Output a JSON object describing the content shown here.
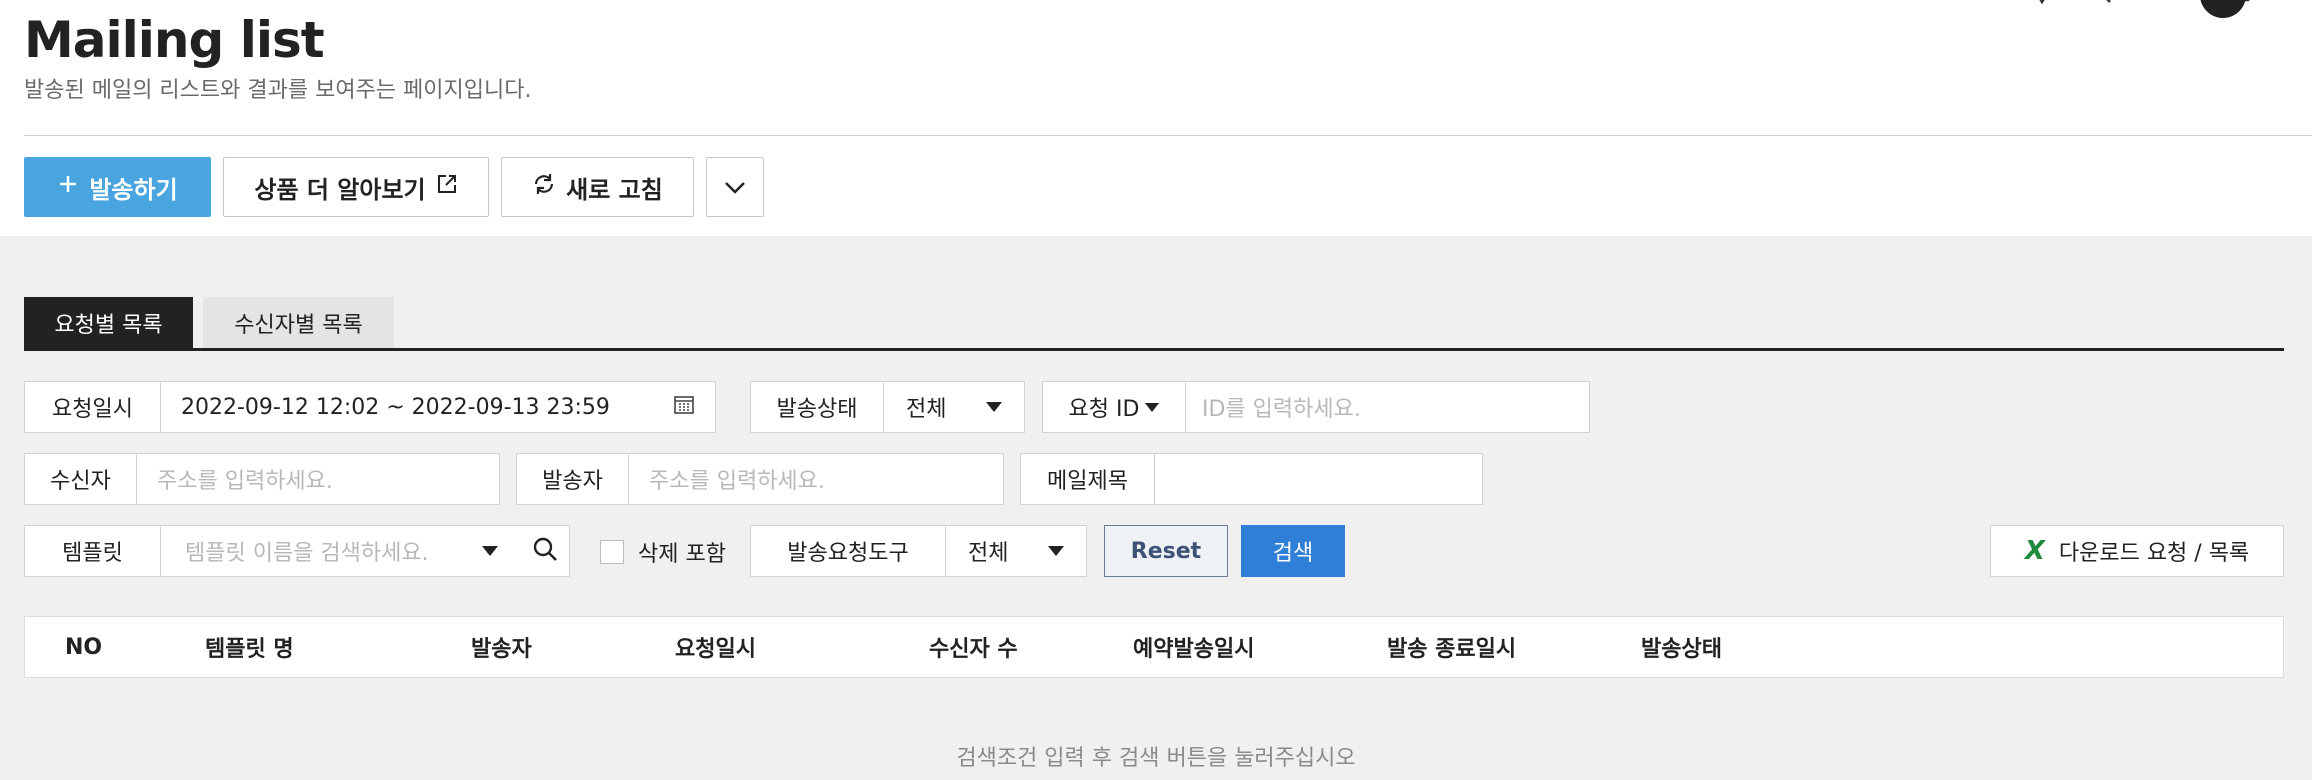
{
  "page": {
    "title": "Mailing list",
    "subtitle": "발송된 메일의 리스트와 결과를 보여주는 페이지입니다."
  },
  "toolbar": {
    "send_label": "발송하기",
    "learn_more_label": "상품 더 알아보기",
    "refresh_label": "새로 고침"
  },
  "tabs": [
    {
      "label": "요청별 목록",
      "active": true
    },
    {
      "label": "수신자별 목록",
      "active": false
    }
  ],
  "filters": {
    "request_date": {
      "label": "요청일시",
      "value": "2022-09-12 12:02 ~ 2022-09-13 23:59"
    },
    "send_status": {
      "label": "발송상태",
      "value": "전체"
    },
    "request_id": {
      "label": "요청 ID",
      "placeholder": "ID를 입력하세요."
    },
    "recipient": {
      "label": "수신자",
      "placeholder": "주소를 입력하세요."
    },
    "sender": {
      "label": "발송자",
      "placeholder": "주소를 입력하세요."
    },
    "mail_subject": {
      "label": "메일제목",
      "value": ""
    },
    "template": {
      "label": "템플릿",
      "placeholder": "템플릿 이름을 검색하세요."
    },
    "include_deleted": {
      "label": "삭제 포함",
      "checked": false
    },
    "send_tool": {
      "label": "발송요청도구",
      "value": "전체"
    }
  },
  "buttons": {
    "reset": "Reset",
    "search": "검색",
    "download": "다운로드 요청 / 목록"
  },
  "table": {
    "columns": [
      "NO",
      "템플릿 명",
      "발송자",
      "요청일시",
      "수신자 수",
      "예약발송일시",
      "발송 종료일시",
      "발송상태"
    ],
    "empty_message": "검색조건 입력 후 검색 버튼을 눌러주십시오"
  },
  "colors": {
    "primary": "#4aa4e0",
    "search": "#2f7ed8",
    "tab_active": "#222222",
    "excel": "#1f8a3c"
  }
}
